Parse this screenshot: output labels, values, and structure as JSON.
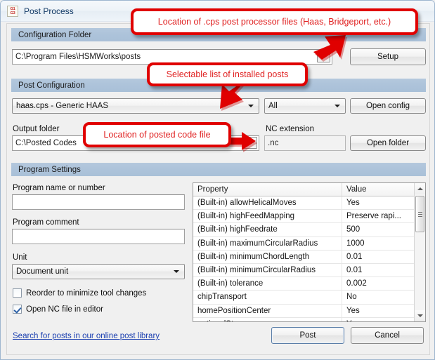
{
  "window": {
    "title": "Post Process",
    "icon": "gcode-icon",
    "icon_line1": "G1",
    "icon_line2": "G3"
  },
  "sections": {
    "configuration_folder": {
      "header": "Configuration Folder",
      "path_value": "C:\\Program Files\\HSMWorks\\posts",
      "browse_label": "...",
      "setup_label": "Setup"
    },
    "post_configuration": {
      "header": "Post Configuration",
      "post_value": "haas.cps - Generic HAAS",
      "filter_value": "All",
      "open_config_label": "Open config",
      "output_folder_label": "Output folder",
      "output_folder_value": "C:\\Posted Codes",
      "output_browse_label": "...",
      "nc_extension_label": "NC extension",
      "nc_extension_value": ".nc",
      "open_folder_label": "Open folder"
    },
    "program_settings": {
      "header": "Program Settings",
      "program_name_label": "Program name or number",
      "program_name_value": "",
      "program_comment_label": "Program comment",
      "program_comment_value": "",
      "unit_label": "Unit",
      "unit_value": "Document unit",
      "reorder_label": "Reorder to minimize tool changes",
      "reorder_checked": false,
      "open_nc_label": "Open NC file in editor",
      "open_nc_checked": true
    }
  },
  "property_grid": {
    "columns": [
      "Property",
      "Value"
    ],
    "rows": [
      {
        "property": "(Built-in) allowHelicalMoves",
        "value": "Yes"
      },
      {
        "property": "(Built-in) highFeedMapping",
        "value": "Preserve rapi..."
      },
      {
        "property": "(Built-in) highFeedrate",
        "value": "500"
      },
      {
        "property": "(Built-in) maximumCircularRadius",
        "value": "1000"
      },
      {
        "property": "(Built-in) minimumChordLength",
        "value": "0.01"
      },
      {
        "property": "(Built-in) minimumCircularRadius",
        "value": "0.01"
      },
      {
        "property": "(Built-in) tolerance",
        "value": "0.002"
      },
      {
        "property": "chipTransport",
        "value": "No"
      },
      {
        "property": "homePositionCenter",
        "value": "Yes"
      },
      {
        "property": "optionalStop",
        "value": "Yes"
      }
    ]
  },
  "footer": {
    "library_link": "Search for posts in our online post library",
    "post_label": "Post",
    "cancel_label": "Cancel"
  },
  "annotations": [
    {
      "text": "Location of .cps post processor files (Haas, Bridgeport, etc.)",
      "arrow": "down-left"
    },
    {
      "text": "Selectable list of installed posts",
      "arrow": "down"
    },
    {
      "text": "Location of posted code file",
      "arrow": "right"
    }
  ],
  "colors": {
    "annotation_red": "#e00000",
    "annotation_text": "#e02020",
    "section_header": "#adc3da",
    "link": "#1b3fb0",
    "title_text": "#123a66"
  }
}
